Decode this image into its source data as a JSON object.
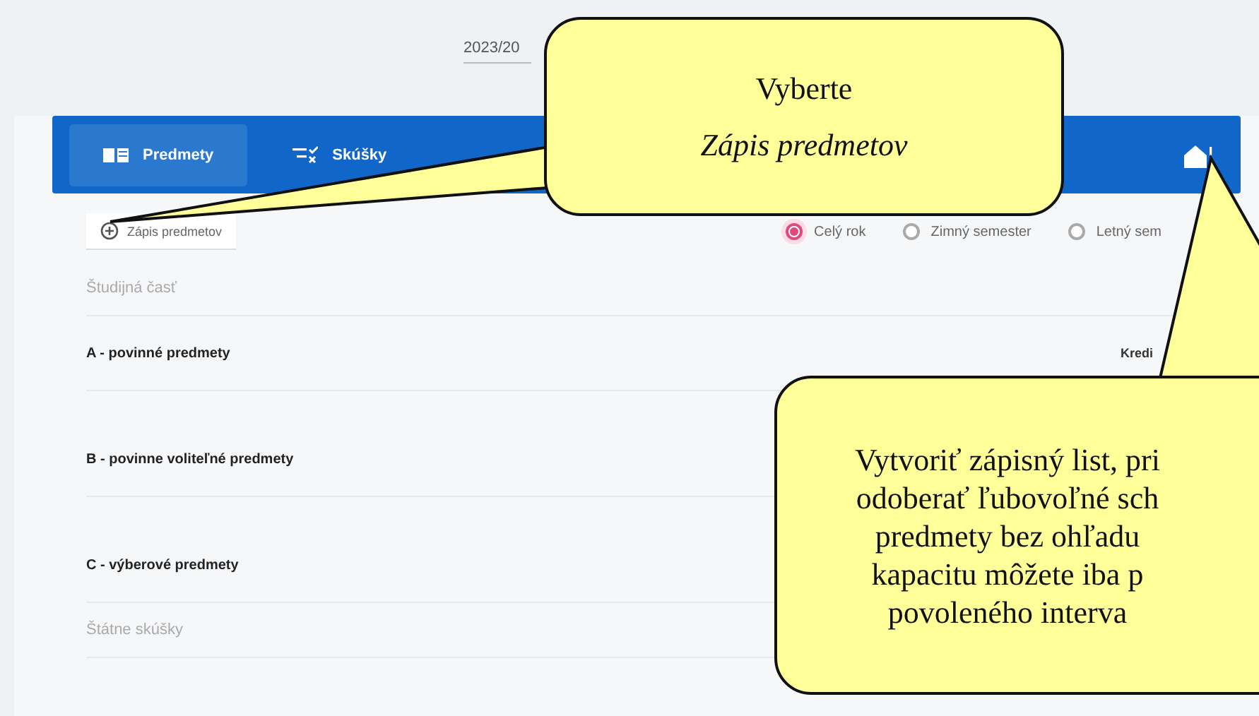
{
  "year_field": {
    "value": "2023/20"
  },
  "tabs": [
    {
      "label": "Predmety",
      "selected": true
    },
    {
      "label": "Skúšky",
      "selected": false
    }
  ],
  "enroll_button": {
    "label": "Zápis predmetov"
  },
  "period_options": [
    {
      "label": "Celý rok",
      "selected": true
    },
    {
      "label": "Zimný semester",
      "selected": false
    },
    {
      "label": "Letný sem",
      "selected": false
    }
  ],
  "sections": [
    {
      "kind": "heading",
      "label": "Študijná časť"
    },
    {
      "kind": "group",
      "label": "A - povinné predmety",
      "column_label": "Kredi"
    },
    {
      "kind": "group",
      "label": "B - povinne voliteľné predmety"
    },
    {
      "kind": "group",
      "label": "C - výberové predmety"
    },
    {
      "kind": "heading",
      "label": "Štátne skúšky"
    }
  ],
  "callouts": [
    {
      "lines": [
        {
          "text": "Vyberte",
          "italic": false
        },
        {
          "text": "Zápis predmetov",
          "italic": true
        }
      ]
    },
    {
      "lines": [
        {
          "text": "Vytvoriť zápisný list, pri",
          "italic": false
        },
        {
          "text": "odoberať ľubovoľné sch",
          "italic": false
        },
        {
          "text": "predmety bez ohľadu",
          "italic": false
        },
        {
          "text": "kapacitu môžete iba p",
          "italic": false
        },
        {
          "text": "povoleného interva",
          "italic": false
        }
      ]
    }
  ]
}
